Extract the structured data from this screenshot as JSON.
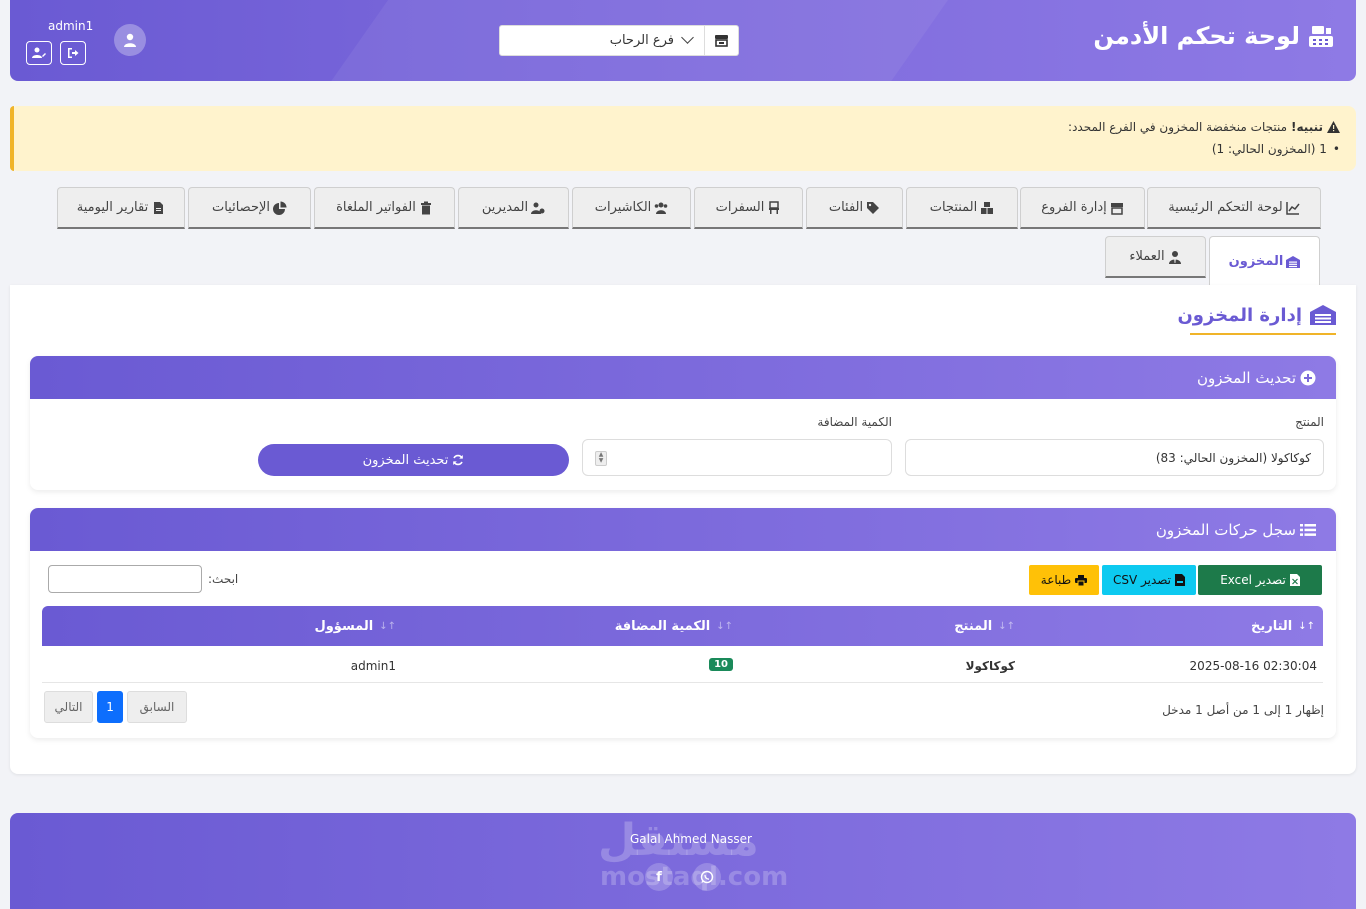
{
  "header": {
    "title": "لوحة تحكم الأدمن",
    "branch_selected": "فرع الرحاب",
    "username": "admin1"
  },
  "alert": {
    "title": "تنبيه!",
    "message": "منتجات منخفضة المخزون في الفرع المحدد:",
    "items": [
      "1 (المخزون الحالي: 1)"
    ]
  },
  "tabs": [
    {
      "label": "لوحة التحكم الرئيسية",
      "icon": "chart-line-icon"
    },
    {
      "label": "إدارة الفروع",
      "icon": "store-icon"
    },
    {
      "label": "المنتجات",
      "icon": "boxes-icon"
    },
    {
      "label": "الفئات",
      "icon": "tags-icon"
    },
    {
      "label": "السفرات",
      "icon": "chair-icon"
    },
    {
      "label": "الكاشيرات",
      "icon": "users-icon"
    },
    {
      "label": "المديرين",
      "icon": "users-cog-icon"
    },
    {
      "label": "الفواتير الملغاة",
      "icon": "trash-icon"
    },
    {
      "label": "الإحصائيات",
      "icon": "pie-chart-icon"
    },
    {
      "label": "تقارير اليومية",
      "icon": "file-icon"
    },
    {
      "label": "المخزون",
      "icon": "warehouse-icon",
      "active": true
    },
    {
      "label": "العملاء",
      "icon": "user-tie-icon"
    }
  ],
  "page": {
    "title": "إدارة المخزون"
  },
  "update_card": {
    "title": "تحديث المخزون",
    "product_label": "المنتج",
    "product_value": "كوكاكولا (المخزون الحالي: 83)",
    "quantity_label": "الكمية المضافة",
    "quantity_value": "",
    "submit_label": "تحديث المخزون"
  },
  "log_card": {
    "title": "سجل حركات المخزون",
    "export_excel": "تصدير Excel",
    "export_csv": "تصدير CSV",
    "print": "طباعة",
    "search_label": "ابحث:",
    "search_value": "",
    "columns": [
      "التاريخ",
      "المنتج",
      "الكمية المضافة",
      "المسؤول"
    ],
    "rows": [
      {
        "date": "2025-08-16 02:30:04",
        "product": "كوكاكولا",
        "quantity": "10",
        "user": "admin1"
      }
    ],
    "info": "إظهار 1 إلى 1 من أصل 1 مدخل",
    "prev_label": "السابق",
    "page_current": "1",
    "next_label": "التالي"
  },
  "footer": {
    "name": "Galal Ahmed Nasser",
    "social": [
      "facebook-icon",
      "whatsapp-icon"
    ],
    "watermark": [
      "مستقل",
      "mostaql.com"
    ]
  },
  "colors": {
    "primary": "#6a5ad3",
    "primary_light": "#8e7ae5",
    "alert_bg": "#fff3cd",
    "accent": "#f0b429",
    "success": "#1a8a5a",
    "info": "#0dcaf0",
    "warning": "#ffc107"
  }
}
